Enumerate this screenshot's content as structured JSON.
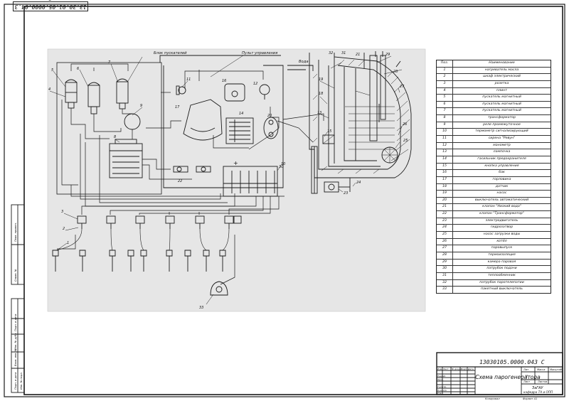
{
  "sheet": {
    "code_top": "13.30.01.05.0000.04.3 С",
    "designation": "13030105.0000.043 С",
    "title": "Схема парогенератора",
    "org": "ЗаГАУ",
    "org2": "кафедра ТА и ОПП",
    "format": "Формат А1",
    "copied": "Копировал",
    "stage": "У",
    "scale": "Масштаб",
    "mass": "Масса",
    "lit": "Лит.",
    "sheet_lbl": "Лист",
    "sheets_lbl": "Листов",
    "rows_tb": [
      "Изм.",
      "Лист",
      "№ докум.",
      "Подп.",
      "Дата",
      "Разраб.",
      "Пров.",
      "Т.контр.",
      "Н.контр.",
      "Утв."
    ],
    "side_labels": [
      "Перв. примен.",
      "Справ. №",
      "Подп. и дата",
      "Инв. № дубл.",
      "Взам. инв. №",
      "Подп. и дата",
      "Инв. № подл."
    ]
  },
  "schema": {
    "block_left": "Блок пускателей",
    "block_right": "Пульт управления",
    "voda": "Вода",
    "plus": "+",
    "labels_num": [
      "1",
      "2",
      "3",
      "4",
      "5",
      "6",
      "7",
      "8",
      "9",
      "10",
      "11",
      "12",
      "13",
      "14",
      "15",
      "16",
      "17",
      "18",
      "19",
      "20",
      "21",
      "22",
      "23",
      "24",
      "25",
      "26",
      "27",
      "28",
      "29",
      "30",
      "31",
      "32",
      "33"
    ]
  },
  "legend": {
    "header_pos": "Поз.",
    "header_name": "Наименование",
    "rows": [
      [
        "1",
        "нагреватель масла"
      ],
      [
        "2",
        "шкаф электрический"
      ],
      [
        "3",
        "розетка"
      ],
      [
        "4",
        "плинт"
      ],
      [
        "5",
        "пускатель магнитный"
      ],
      [
        "6",
        "пускатель магнитный"
      ],
      [
        "7",
        "пускатель магнитный"
      ],
      [
        "8",
        "трансформатор"
      ],
      [
        "9",
        "реле промежуточное"
      ],
      [
        "10",
        "термометр сигнализирующий"
      ],
      [
        "11",
        "сирена \"Ревун\""
      ],
      [
        "12",
        "манометр"
      ],
      [
        "13",
        "лампочка"
      ],
      [
        "14",
        "гасильник предохранителя"
      ],
      [
        "15",
        "кнопка управления"
      ],
      [
        "16",
        "бак"
      ],
      [
        "17",
        "горловина"
      ],
      [
        "18",
        "датчик"
      ],
      [
        "19",
        "насос"
      ],
      [
        "20",
        "выключатель автоматический"
      ],
      [
        "21",
        "клапан \"Низкий вода\""
      ],
      [
        "22",
        "клапан \"Трансформатор\""
      ],
      [
        "23",
        "электродвигатель"
      ],
      [
        "24",
        "гидрозатвор"
      ],
      [
        "25",
        "насос загрузки воды"
      ],
      [
        "26",
        "котёл"
      ],
      [
        "27",
        "паровыпуск"
      ],
      [
        "28",
        "термоизоляция"
      ],
      [
        "29",
        "камера паровая"
      ],
      [
        "30",
        "патрубок подачи"
      ],
      [
        "31",
        "теплообменник"
      ],
      [
        "32",
        "патрубок паротелепатии"
      ],
      [
        "33",
        "пакетный выключатель"
      ]
    ]
  }
}
